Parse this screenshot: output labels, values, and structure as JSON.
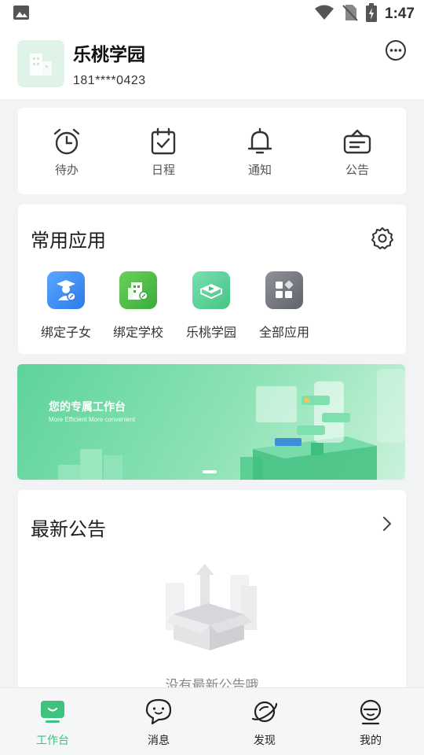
{
  "status_bar": {
    "time": "1:47",
    "icons": [
      "image-icon",
      "wifi-icon",
      "no-sim-icon",
      "battery-charging-icon"
    ]
  },
  "header": {
    "school_name": "乐桃学园",
    "phone": "181****0423",
    "more_icon": "more-horizontal-icon"
  },
  "quick_actions": [
    {
      "label": "待办",
      "icon": "alarm-clock-icon"
    },
    {
      "label": "日程",
      "icon": "calendar-check-icon"
    },
    {
      "label": "通知",
      "icon": "bell-icon"
    },
    {
      "label": "公告",
      "icon": "announcement-icon"
    }
  ],
  "common_apps": {
    "title": "常用应用",
    "settings_icon": "gear-icon",
    "items": [
      {
        "label": "绑定子女",
        "icon": "graduate-link-icon",
        "color": "#3d8ff2"
      },
      {
        "label": "绑定学校",
        "icon": "school-link-icon",
        "color": "#4cc64c"
      },
      {
        "label": "乐桃学园",
        "icon": "play-book-icon",
        "color": "#5fd39c"
      },
      {
        "label": "全部应用",
        "icon": "grid-apps-icon",
        "color": "#767a80"
      }
    ]
  },
  "banner": {
    "title": "您的专属工作台",
    "subtitle": "More Efficient  More convenient",
    "colors": {
      "start": "#5ed39a",
      "end": "#c9f2da"
    }
  },
  "notices": {
    "title": "最新公告",
    "empty_text": "没有最新公告哦"
  },
  "tabbar": {
    "active_color": "#3fc27f",
    "items": [
      {
        "label": "工作台",
        "icon": "workbench-icon",
        "active": true
      },
      {
        "label": "消息",
        "icon": "chat-bubble-icon",
        "active": false
      },
      {
        "label": "发现",
        "icon": "planet-icon",
        "active": false
      },
      {
        "label": "我的",
        "icon": "profile-icon",
        "active": false
      }
    ]
  }
}
